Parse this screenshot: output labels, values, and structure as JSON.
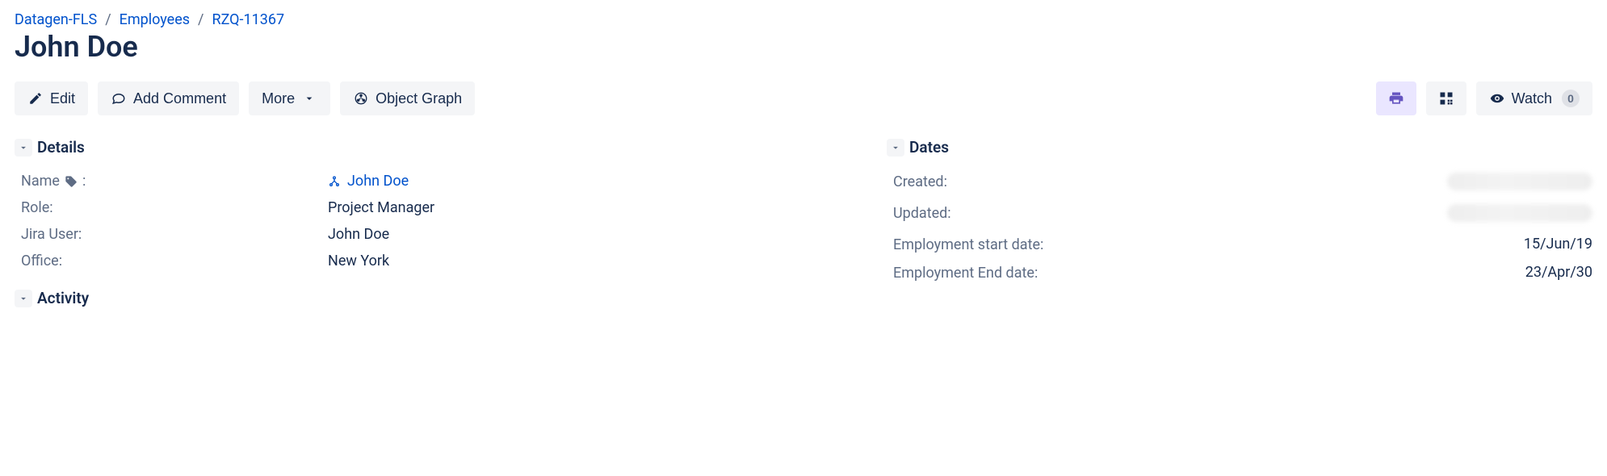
{
  "breadcrumb": {
    "root": "Datagen-FLS",
    "section": "Employees",
    "id": "RZQ-11367"
  },
  "page_title": "John Doe",
  "toolbar": {
    "edit": "Edit",
    "add_comment": "Add Comment",
    "more": "More",
    "object_graph": "Object Graph",
    "watch": "Watch",
    "watch_count": "0"
  },
  "sections": {
    "details": "Details",
    "activity": "Activity",
    "dates": "Dates"
  },
  "details": {
    "labels": {
      "name": "Name",
      "role": "Role:",
      "jira_user": "Jira User:",
      "office": "Office:"
    },
    "name_link": "John Doe",
    "role": "Project Manager",
    "jira_user": "John Doe",
    "office": "New York"
  },
  "dates": {
    "labels": {
      "created": "Created:",
      "updated": "Updated:",
      "emp_start": "Employment start date:",
      "emp_end": "Employment End date:"
    },
    "emp_start": "15/Jun/19",
    "emp_end": "23/Apr/30"
  }
}
